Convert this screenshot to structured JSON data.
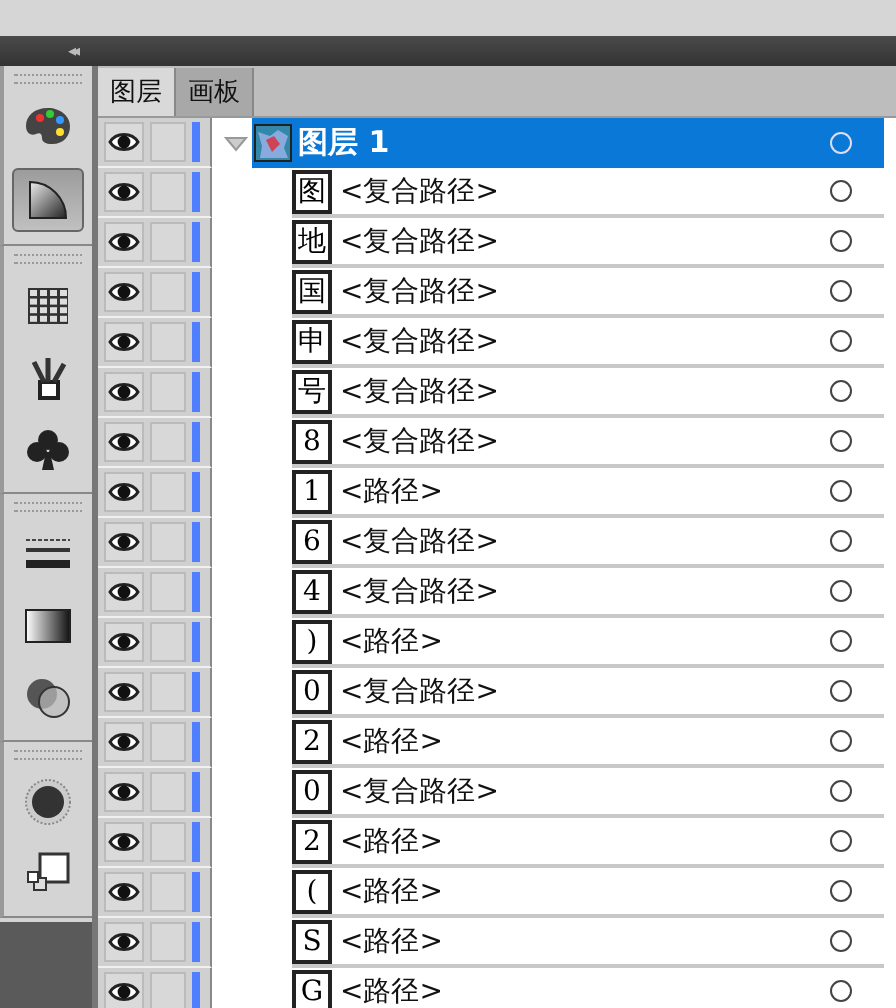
{
  "panel": {
    "collapse_glyph": "◂◂"
  },
  "toolbar": {
    "groups": [
      [
        {
          "kind": "palette",
          "selected": false
        },
        {
          "kind": "quarter",
          "selected": true
        }
      ],
      [
        {
          "kind": "grid",
          "selected": false
        },
        {
          "kind": "brushes",
          "selected": false
        },
        {
          "kind": "club",
          "selected": false
        }
      ],
      [
        {
          "kind": "stroke",
          "selected": false
        },
        {
          "kind": "gradient",
          "selected": false
        },
        {
          "kind": "overlap",
          "selected": false
        }
      ],
      [
        {
          "kind": "sphere",
          "selected": false
        },
        {
          "kind": "squares",
          "selected": false
        }
      ]
    ]
  },
  "tabs": [
    {
      "label": "图层",
      "selected": true
    },
    {
      "label": "画板",
      "selected": false
    }
  ],
  "layer": {
    "name": "图层 1",
    "expanded": true,
    "selected": true
  },
  "items": [
    {
      "thumb": "图",
      "name": "<复合路径>"
    },
    {
      "thumb": "地",
      "name": "<复合路径>"
    },
    {
      "thumb": "国",
      "name": "<复合路径>"
    },
    {
      "thumb": "申",
      "name": "<复合路径>"
    },
    {
      "thumb": "号",
      "name": "<复合路径>"
    },
    {
      "thumb": "8",
      "name": "<复合路径>"
    },
    {
      "thumb": "1",
      "name": "<路径>"
    },
    {
      "thumb": "6",
      "name": "<复合路径>"
    },
    {
      "thumb": "4",
      "name": "<复合路径>"
    },
    {
      "thumb": ")",
      "name": "<路径>"
    },
    {
      "thumb": "0",
      "name": "<复合路径>"
    },
    {
      "thumb": "2",
      "name": "<路径>"
    },
    {
      "thumb": "0",
      "name": "<复合路径>"
    },
    {
      "thumb": "2",
      "name": "<路径>"
    },
    {
      "thumb": "(",
      "name": "<路径>"
    },
    {
      "thumb": "S",
      "name": "<路径>"
    },
    {
      "thumb": "G",
      "name": "<路径>"
    }
  ]
}
